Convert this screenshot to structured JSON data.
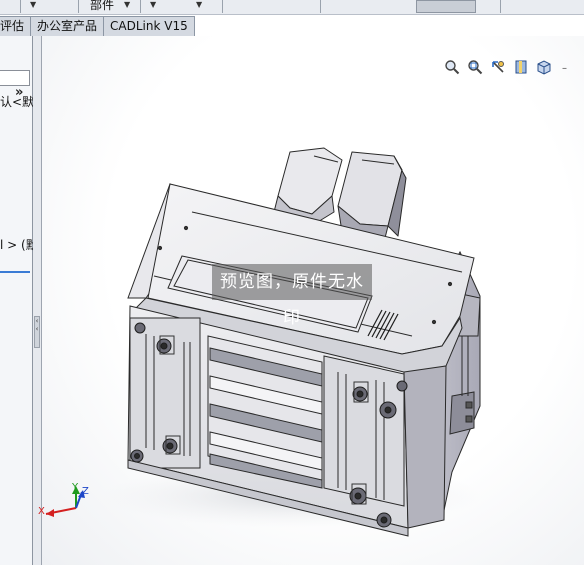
{
  "top_toolbar": {
    "label": "部件"
  },
  "tabs": [
    {
      "label": "评估"
    },
    {
      "label": "办公室产品"
    },
    {
      "label": "CADLink V15"
    }
  ],
  "left_panel": {
    "collapse_glyph": "»",
    "item_text_1": "认<默",
    "item_text_2": "l > (默"
  },
  "viewport": {
    "watermark": "预览图，原件无水印",
    "triad": {
      "x": "X",
      "y": "Y",
      "z": "Z"
    }
  },
  "hud_icons": [
    "zoom-to-fit-icon",
    "zoom-to-area-icon",
    "previous-view-icon",
    "section-view-icon",
    "view-orientation-icon",
    "display-style-icon"
  ],
  "colors": {
    "accent": "#3a7bd5",
    "tab_bg": "#d4d9e1"
  }
}
